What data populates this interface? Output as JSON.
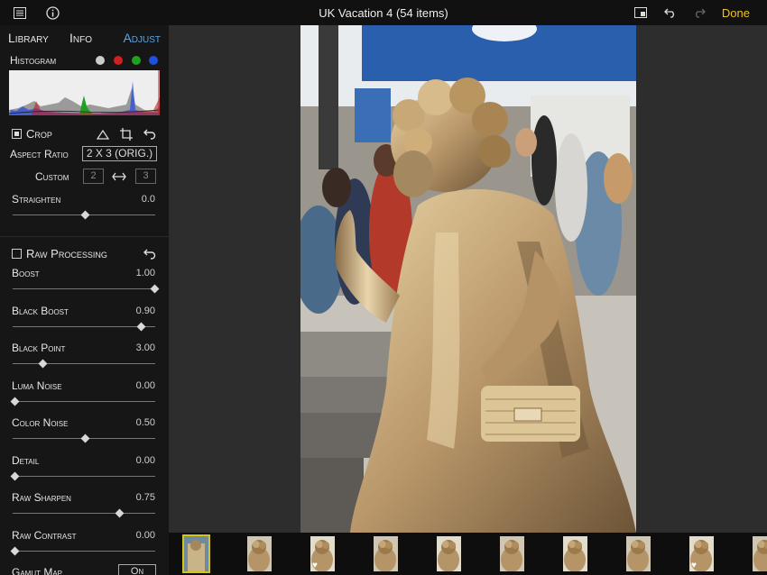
{
  "toolbar": {
    "title": "UK Vacation 4 (54 items)",
    "done_label": "Done"
  },
  "sidebar": {
    "tabs": {
      "library": "Library",
      "info": "Info",
      "adjust": "Adjust",
      "active": "adjust"
    },
    "histogram": {
      "label": "Histogram",
      "channels": [
        "#cccccc",
        "#d02020",
        "#20a020",
        "#2050e0"
      ]
    },
    "crop": {
      "label": "Crop",
      "checked": true,
      "aspect_ratio_label": "Aspect Ratio",
      "aspect_ratio_value": "2 X 3 (ORIG.)",
      "custom_label": "Custom",
      "custom_w": "2",
      "custom_h": "3",
      "straighten_label": "Straighten",
      "straighten_value": "0.0",
      "straighten_level": 0.5
    },
    "raw": {
      "label": "Raw Processing",
      "checked": false,
      "sliders": [
        {
          "label": "Boost",
          "value": "1.00",
          "level": 1.0
        },
        {
          "label": "Black Boost",
          "value": "0.90",
          "level": 0.9
        },
        {
          "label": "Black Point",
          "value": "3.00",
          "level": 0.2
        },
        {
          "label": "Luma Noise",
          "value": "0.00",
          "level": 0.0
        },
        {
          "label": "Color Noise",
          "value": "0.50",
          "level": 0.5
        },
        {
          "label": "Detail",
          "value": "0.00",
          "level": 0.0
        },
        {
          "label": "Raw Sharpen",
          "value": "0.75",
          "level": 0.75
        },
        {
          "label": "Raw Contrast",
          "value": "0.00",
          "level": 0.0
        }
      ],
      "gamut_map_label": "Gamut Map",
      "gamut_map_value": "On"
    }
  },
  "filmstrip": {
    "thumbnails": [
      {
        "selected": true,
        "favorite": false
      },
      {
        "selected": false,
        "favorite": false
      },
      {
        "selected": false,
        "favorite": true
      },
      {
        "selected": false,
        "favorite": false
      },
      {
        "selected": false,
        "favorite": false
      },
      {
        "selected": false,
        "favorite": false
      },
      {
        "selected": false,
        "favorite": false
      },
      {
        "selected": false,
        "favorite": false
      },
      {
        "selected": false,
        "favorite": true
      },
      {
        "selected": false,
        "favorite": false
      }
    ]
  }
}
